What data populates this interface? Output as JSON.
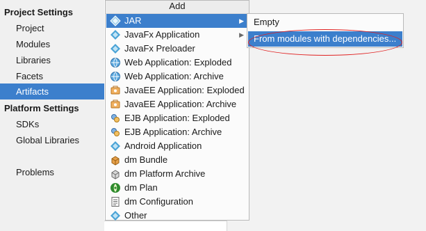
{
  "sidebar": {
    "project_settings_header": "Project Settings",
    "project_items": [
      "Project",
      "Modules",
      "Libraries",
      "Facets",
      "Artifacts"
    ],
    "platform_settings_header": "Platform Settings",
    "platform_items": [
      "SDKs",
      "Global Libraries"
    ],
    "problems": "Problems",
    "selected_item": "Artifacts"
  },
  "add_menu": {
    "title": "Add",
    "items": [
      {
        "label": "JAR",
        "icon": "jar-diamond-icon",
        "has_submenu": true,
        "selected": true
      },
      {
        "label": "JavaFx Application",
        "icon": "javafx-diamond-icon",
        "has_submenu": true
      },
      {
        "label": "JavaFx Preloader",
        "icon": "javafx-diamond-icon"
      },
      {
        "label": "Web Application: Exploded",
        "icon": "web-globe-icon"
      },
      {
        "label": "Web Application: Archive",
        "icon": "web-globe-icon"
      },
      {
        "label": "JavaEE Application: Exploded",
        "icon": "javaee-icon"
      },
      {
        "label": "JavaEE Application: Archive",
        "icon": "javaee-icon"
      },
      {
        "label": "EJB Application: Exploded",
        "icon": "ejb-icon"
      },
      {
        "label": "EJB Application: Archive",
        "icon": "ejb-icon"
      },
      {
        "label": "Android Application",
        "icon": "android-diamond-icon"
      },
      {
        "label": "dm Bundle",
        "icon": "dm-bundle-icon"
      },
      {
        "label": "dm Platform Archive",
        "icon": "dm-platform-icon"
      },
      {
        "label": "dm Plan",
        "icon": "dm-plan-icon"
      },
      {
        "label": "dm Configuration",
        "icon": "dm-configuration-icon"
      },
      {
        "label": "Other",
        "icon": "other-diamond-icon"
      }
    ]
  },
  "jar_submenu": {
    "items": [
      {
        "label": "Empty",
        "selected": false
      },
      {
        "label": "From modules with dependencies...",
        "selected": true
      }
    ]
  },
  "colors": {
    "selection": "#3c7fcc",
    "highlight_ring": "#e02020"
  }
}
